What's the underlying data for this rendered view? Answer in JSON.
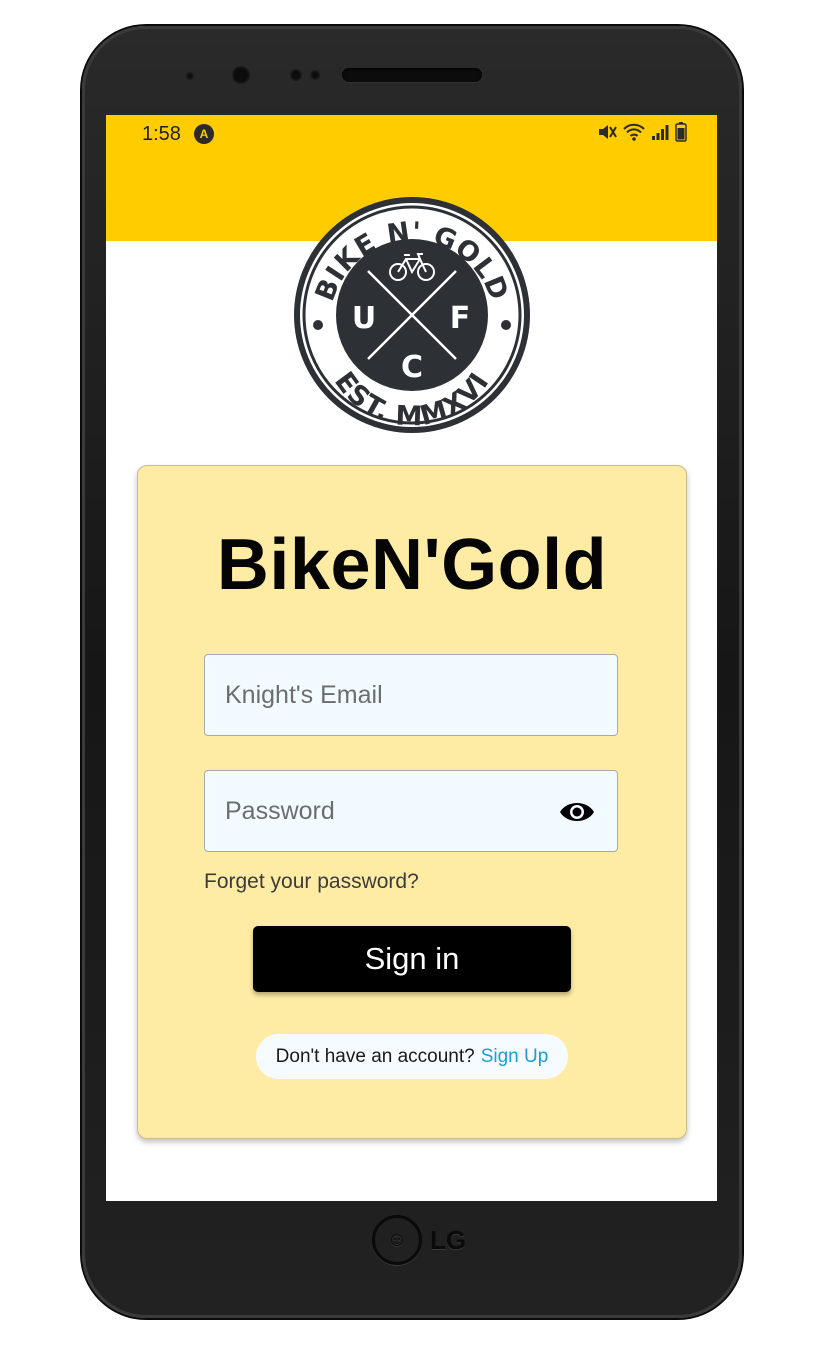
{
  "status_bar": {
    "time": "1:58",
    "app_icon": "A",
    "icons": [
      "mute-icon",
      "wifi-icon",
      "signal-icon",
      "battery-icon"
    ],
    "background": "#ffcc00"
  },
  "logo": {
    "top_text": "BIKE N' GOLD",
    "bottom_text": "EST. MMXVI",
    "letters": [
      "U",
      "F",
      "C"
    ]
  },
  "card": {
    "title": "BikeN'Gold",
    "email": {
      "placeholder": "Knight's Email",
      "value": ""
    },
    "password": {
      "placeholder": "Password",
      "value": ""
    },
    "forgot_label": "Forget your password?",
    "signin_label": "Sign in",
    "signup_prompt": "Don't have an account?",
    "signup_link": "Sign Up",
    "background": "#ffeca4"
  },
  "device": {
    "brand": "LG"
  }
}
